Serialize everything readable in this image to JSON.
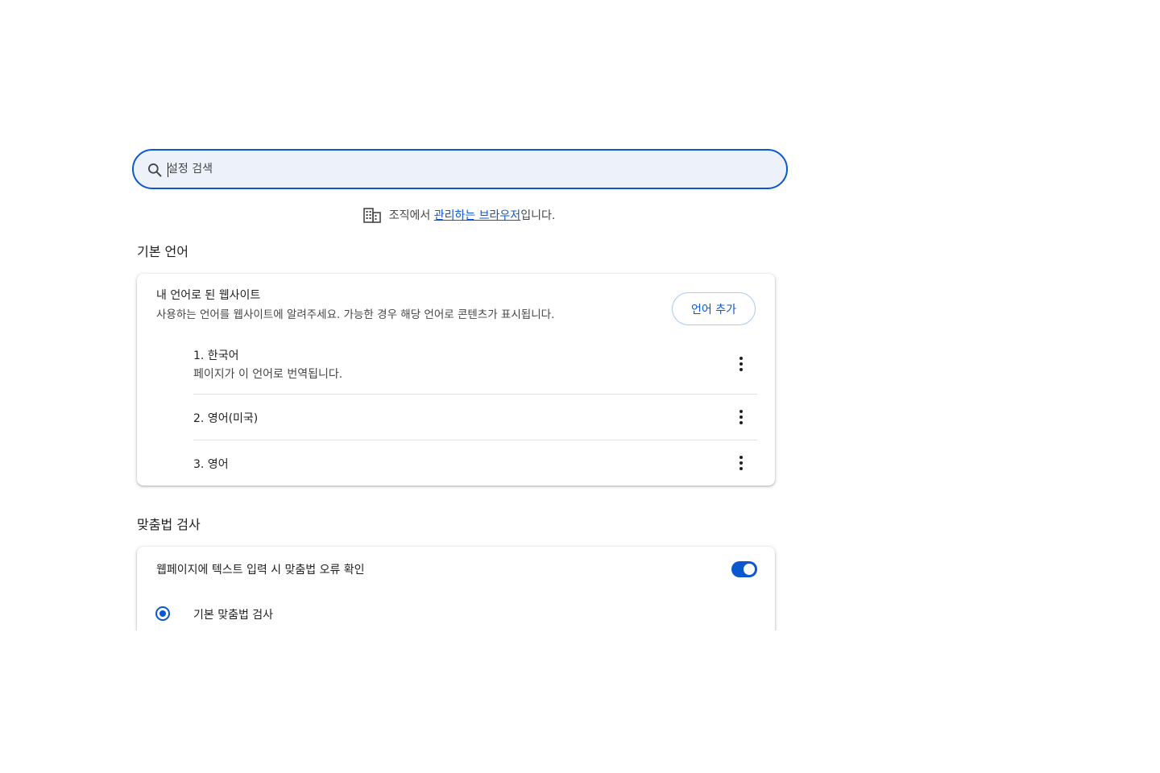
{
  "search": {
    "placeholder": "설정 검색"
  },
  "managed_notice": {
    "prefix": "조직에서 ",
    "link": "관리하는 브라우저",
    "suffix": "입니다."
  },
  "sections": {
    "preferred_languages": {
      "title": "기본 언어",
      "card_title": "내 언어로 된 웹사이트",
      "card_subtitle": "사용하는 언어를 웹사이트에 알려주세요. 가능한 경우 해당 언어로 콘텐츠가 표시됩니다.",
      "add_button": "언어 추가",
      "languages": [
        {
          "label": "1. 한국어",
          "description": "페이지가 이 언어로 번역됩니다."
        },
        {
          "label": "2. 영어(미국)"
        },
        {
          "label": "3. 영어"
        }
      ]
    },
    "spell_check": {
      "title": "맞춤법 검사",
      "toggle_label": "웹페이지에 텍스트 입력 시 맞춤법 오류 확인",
      "toggle_on": true,
      "options": [
        {
          "label": "기본 맞춤법 검사",
          "selected": true
        }
      ]
    }
  },
  "colors": {
    "accent": "#0b57d0",
    "search_bg": "#edf2fa",
    "button_border": "#a8c7fa"
  },
  "icons": {
    "search": "search-icon",
    "managed": "building-icon",
    "more": "more-vert-icon"
  }
}
